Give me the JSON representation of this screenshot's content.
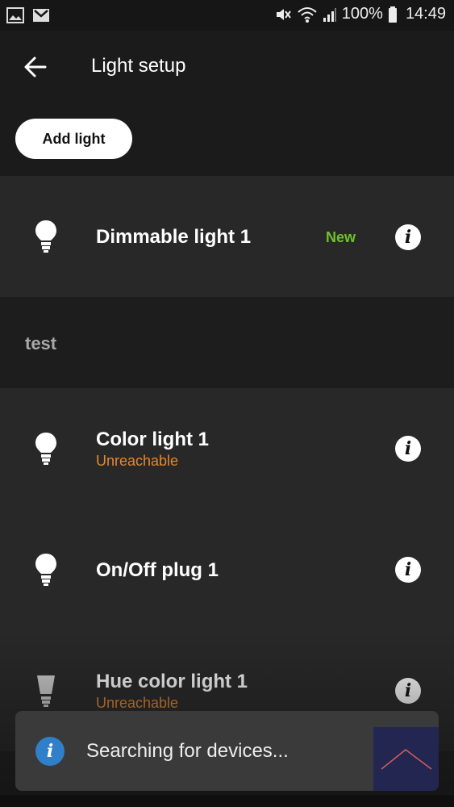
{
  "status_bar": {
    "battery": "100%",
    "time": "14:49",
    "icons": [
      "image-icon",
      "gmail-icon",
      "mute-icon",
      "wifi-icon",
      "signal-icon",
      "battery-icon"
    ]
  },
  "header": {
    "title": "Light setup",
    "back_icon": "arrow-left-icon"
  },
  "toolbar": {
    "add_label": "Add light"
  },
  "unassigned": {
    "lights": [
      {
        "name": "Dimmable light 1",
        "badge": "New"
      }
    ]
  },
  "group": {
    "title": "test",
    "lights": [
      {
        "name": "Color light 1",
        "status": "Unreachable"
      },
      {
        "name": "On/Off plug 1",
        "status": ""
      },
      {
        "name": "Hue color light 1",
        "status": "Unreachable"
      }
    ]
  },
  "snackbar": {
    "text": "Searching for devices..."
  },
  "colors": {
    "accent_new": "#6fc22a",
    "unreachable": "#e4882f",
    "info_blue": "#2f7fc9"
  }
}
